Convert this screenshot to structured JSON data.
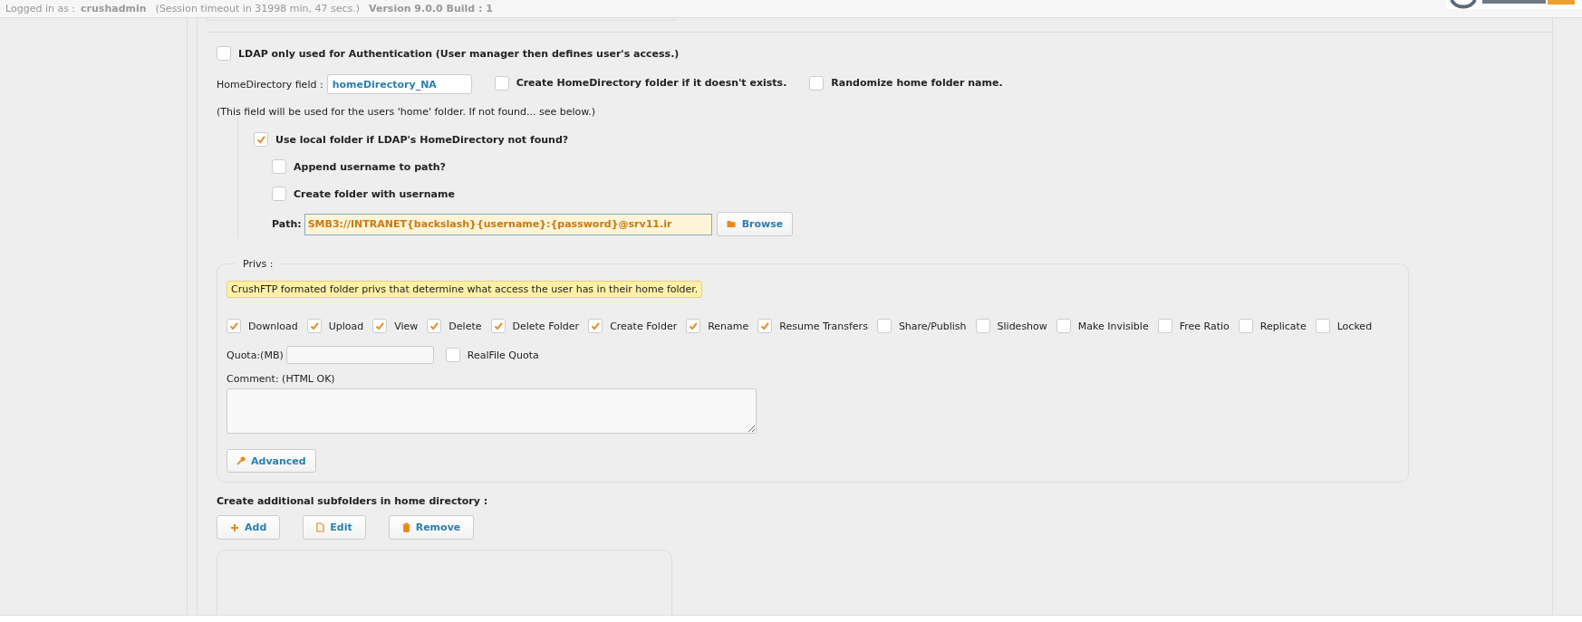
{
  "header": {
    "logged_in_label": "Logged in as :",
    "username": "crushadmin",
    "session": "(Session timeout in 31998 min, 47 secs.)",
    "version": "Version 9.0.0 Build : 1"
  },
  "ldap_only": {
    "label": "LDAP only used for Authentication (User manager then defines user's access.)",
    "checked": false
  },
  "home_directory": {
    "label": "HomeDirectory field :",
    "value": "homeDirectory_NA"
  },
  "create_home": {
    "label": "Create HomeDirectory folder if it doesn't exists.",
    "checked": false
  },
  "randomize": {
    "label": "Randomize home folder name.",
    "checked": false
  },
  "note": "(This field will be used for the users 'home' folder. If not found... see below.)",
  "use_local": {
    "label": "Use local folder if LDAP's HomeDirectory not found?",
    "checked": true
  },
  "append_username": {
    "label": "Append username to path?",
    "checked": false
  },
  "create_folder": {
    "label": "Create folder with username",
    "checked": false
  },
  "path": {
    "label": "Path:",
    "value": "SMB3://INTRANET{backslash}{username}:{password}@srv11.ir"
  },
  "browse_button": "Browse",
  "privs": {
    "legend": "Privs :",
    "description": "CrushFTP formated folder privs that determine what access the user has in their home folder.",
    "permissions": [
      {
        "label": "Download",
        "checked": true
      },
      {
        "label": "Upload",
        "checked": true
      },
      {
        "label": "View",
        "checked": true
      },
      {
        "label": "Delete",
        "checked": true
      },
      {
        "label": "Delete Folder",
        "checked": true
      },
      {
        "label": "Create Folder",
        "checked": true
      },
      {
        "label": "Rename",
        "checked": true
      },
      {
        "label": "Resume Transfers",
        "checked": true
      },
      {
        "label": "Share/Publish",
        "checked": false
      },
      {
        "label": "Slideshow",
        "checked": false
      },
      {
        "label": "Make Invisible",
        "checked": false
      },
      {
        "label": "Free Ratio",
        "checked": false
      },
      {
        "label": "Replicate",
        "checked": false
      },
      {
        "label": "Locked",
        "checked": false
      }
    ],
    "quota_label": "Quota:(MB)",
    "realfile_quota": {
      "label": "RealFile Quota",
      "checked": false
    },
    "comment_label": "Comment: (HTML OK)",
    "advanced_button": "Advanced"
  },
  "subfolders": {
    "title": "Create additional subfolders in home directory :",
    "buttons": [
      {
        "kind": "add",
        "label": "Add"
      },
      {
        "kind": "edit",
        "label": "Edit"
      },
      {
        "kind": "remove",
        "label": "Remove"
      }
    ]
  }
}
